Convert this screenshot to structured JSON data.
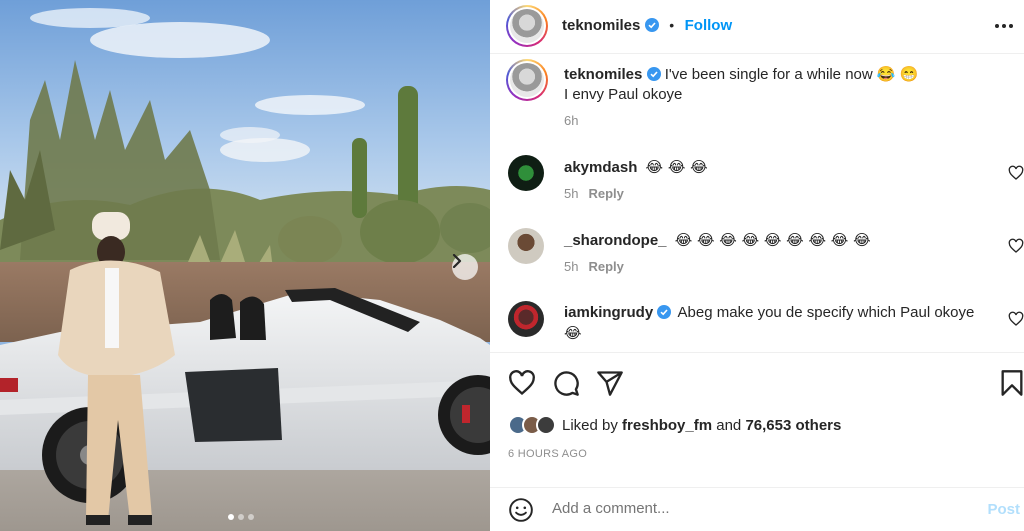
{
  "post": {
    "author": "teknomiles",
    "follow_separator": "•",
    "follow_label": "Follow",
    "caption_line1": "I've been single for a while now 😂 😁",
    "caption_line2": "I envy Paul okoye",
    "caption_time": "6h",
    "carousel": {
      "total": 3,
      "active_index": 0
    }
  },
  "comments": [
    {
      "username": "akymdash",
      "text": "😂 😂 😂",
      "time": "5h",
      "reply_label": "Reply",
      "verified": false
    },
    {
      "username": "_sharondope_",
      "text": "😂 😂 😂 😂 😂 😂 😂 😂 😂",
      "time": "5h",
      "reply_label": "Reply",
      "verified": false
    },
    {
      "username": "iamkingrudy",
      "text": "Abeg make you de specify which Paul okoye",
      "text_line2": "😂",
      "verified": true
    }
  ],
  "likes": {
    "prefix": "Liked by",
    "liker": "freshboy_fm",
    "conjunction": "and",
    "others": "76,653 others"
  },
  "timestamp": "6 HOURS AGO",
  "composer": {
    "placeholder": "Add a comment...",
    "post_label": "Post"
  },
  "colors": {
    "accent": "#0095f6",
    "post_disabled": "#b2dffc",
    "verified": "#3897f0",
    "muted": "#8e8e8e"
  },
  "icons": {
    "header": [
      "verified-badge-icon",
      "more-options-icon"
    ],
    "actions": [
      "heart-icon",
      "comment-icon",
      "share-icon",
      "bookmark-icon"
    ],
    "composer": [
      "emoji-icon"
    ]
  }
}
